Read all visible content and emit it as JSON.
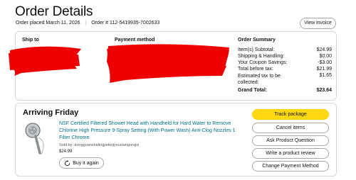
{
  "header": {
    "title": "Order Details",
    "order_placed_label": "Order placed March 11, 2026",
    "order_number_label": "Order # 112-5419935-7002633",
    "view_invoice": "View invoice"
  },
  "summary": {
    "ship_to_heading": "Ship to",
    "payment_heading": "Payment method",
    "order_summary_heading": "Order Summary",
    "rows": [
      {
        "label": "Item(s) Subtotal:",
        "value": "$24.99"
      },
      {
        "label": "Shipping & Handling:",
        "value": "$0.00"
      },
      {
        "label": "Your Coupon Savings:",
        "value": "-$3.00"
      },
      {
        "label": "Total before tax:",
        "value": "$21.99"
      },
      {
        "label": "Estimated tax to be collected:",
        "value": "$1.65"
      },
      {
        "label": "Grand Total:",
        "value": "$23.64"
      }
    ]
  },
  "shipment": {
    "arriving": "Arriving Friday",
    "product_title": "NSF Certified Filtered Shower Head with Handheld for Hard Water to Remove Chlorine High Pressure 9-Spray Setting (With Power Wash) Anti-Clog Nozzles 1 Filter Chrome",
    "sold_by": "Sold by: dongguanshidingjiekejiyouxiangongsi",
    "price": "$24.99",
    "buy_again": "Buy it again",
    "actions": {
      "track": "Track package",
      "cancel": "Cancel items",
      "ask": "Ask Product Question",
      "review": "Write a product review",
      "change_payment": "Change Payment Method"
    }
  },
  "colors": {
    "primary_button": "#ffd814",
    "link": "#007185",
    "redaction": "#ee0000"
  }
}
